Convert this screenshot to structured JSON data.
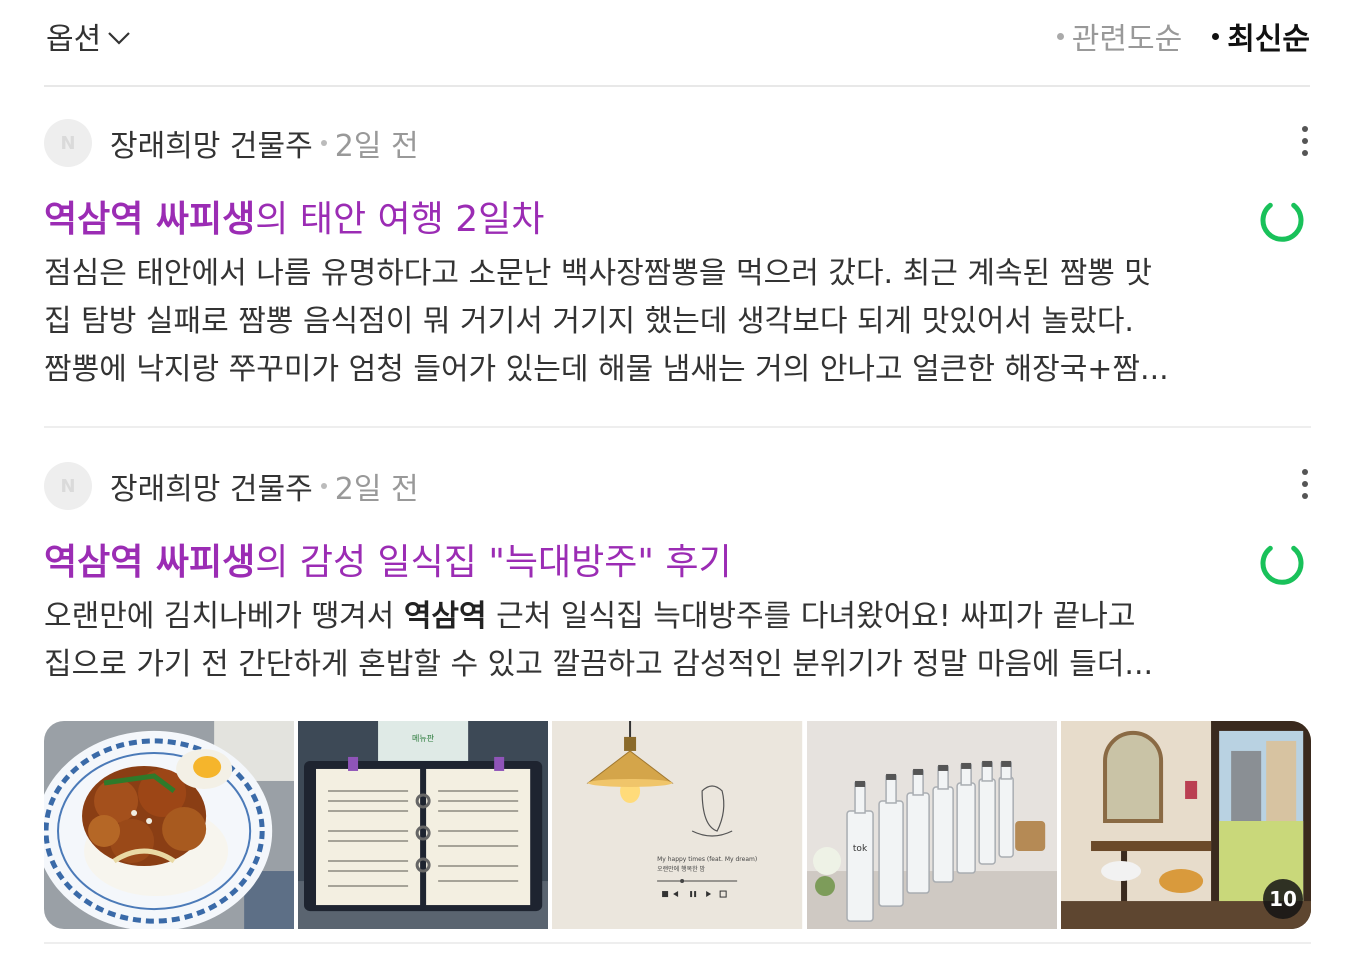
{
  "toolbar": {
    "options_label": "옵션",
    "sort_relevance": "관련도순",
    "sort_latest": "최신순"
  },
  "posts": [
    {
      "avatar_letter": "N",
      "author": "장래희망 건물주",
      "time": "2일 전",
      "title_highlight": "역삼역 싸피생",
      "title_rest": "의 태안 여행 2일차",
      "desc_lines": [
        "점심은 태안에서 나름 유명하다고 소문난 백사장짬뽕을 먹으러 갔다. 최근 계속된 짬뽕 맛",
        "집 탐방 실패로 짬뽕 음식점이 뭐 거기서 거기지 했는데 생각보다 되게 맛있어서 놀랐다.",
        "짬뽕에 낙지랑 쭈꾸미가 엄청 들어가 있는데 해물 냄새는 거의 안나고 얼큰한 해장국+짬..."
      ]
    },
    {
      "avatar_letter": "N",
      "author": "장래희망 건물주",
      "time": "2일 전",
      "title_highlight": "역삼역 싸피생",
      "title_rest": "의 감성 일식집 \"늑대방주\" 후기",
      "desc_line1_pre": "오랜만에 김치나베가 땡겨서 ",
      "desc_line1_bold": "역삼역",
      "desc_line1_post": " 근처 일식집 늑대방주를 다녀왔어요! 싸피가 끝나고",
      "desc_line2": "집으로 가기 전 간단하게 혼밥할 수 있고 깔끔하고 감성적인 분위기가 정말 마음에 들더...",
      "image_count": "10",
      "thumb_texts": {
        "menu_sign": "메뉴판",
        "poster_song": "My happy times (feat. My dream)",
        "poster_sub": "오랜만에 행복한 밤",
        "bottle_label": "tok"
      }
    }
  ],
  "colors": {
    "title_purple": "#9b2cb4",
    "ring_green": "#19c15a"
  }
}
